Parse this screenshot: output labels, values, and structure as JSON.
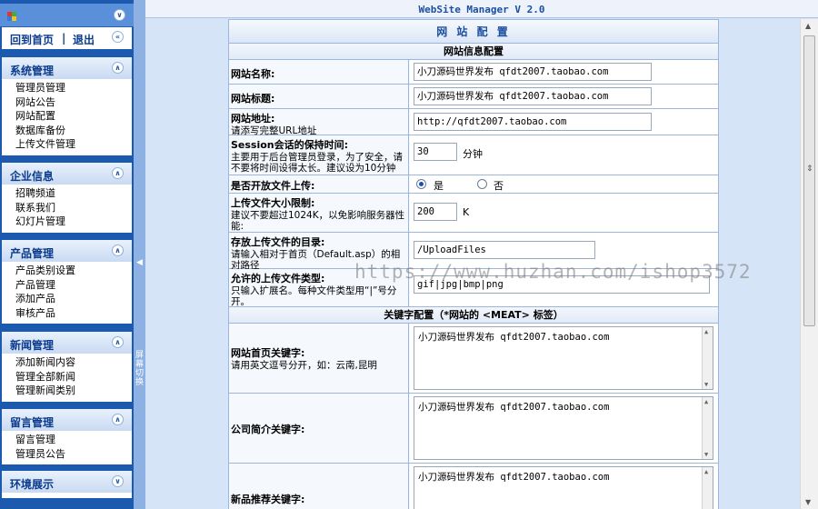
{
  "app": {
    "title": "WebSite Manager V 2.0"
  },
  "sidebar": {
    "home_link": "回到首页",
    "separator": "|",
    "logout_link": "退出",
    "groups": [
      {
        "title": "系统管理",
        "items": [
          "管理员管理",
          "网站公告",
          "网站配置",
          "数据库备份",
          "上传文件管理"
        ]
      },
      {
        "title": "企业信息",
        "items": [
          "招聘频道",
          "联系我们",
          "幻灯片管理"
        ]
      },
      {
        "title": "产品管理",
        "items": [
          "产品类别设置",
          "产品管理",
          "添加产品",
          "审核产品"
        ]
      },
      {
        "title": "新闻管理",
        "items": [
          "添加新闻内容",
          "管理全部新闻",
          "管理新闻类别"
        ]
      },
      {
        "title": "留言管理",
        "items": [
          "留言管理",
          "管理员公告"
        ]
      },
      {
        "title": "环境展示",
        "items": []
      }
    ]
  },
  "splitter": {
    "label": "屏幕切换"
  },
  "form": {
    "caption": "网 站 配 置",
    "section_info": "网站信息配置",
    "site_name": {
      "label": "网站名称:",
      "value": "小刀源码世界发布 qfdt2007.taobao.com"
    },
    "site_title": {
      "label": "网站标题:",
      "value": "小刀源码世界发布 qfdt2007.taobao.com"
    },
    "site_url": {
      "label": "网站地址:",
      "hint": "请添写完整URL地址",
      "value": "http://qfdt2007.taobao.com"
    },
    "session": {
      "label": "Session会话的保持时间:",
      "hint": "主要用于后台管理员登录，为了安全，请不要将时间设得太长。建议设为10分钟",
      "value": "30",
      "unit": "分钟"
    },
    "upload_open": {
      "label": "是否开放文件上传:",
      "yes": "是",
      "no": "否",
      "selected": "yes"
    },
    "upload_size": {
      "label": "上传文件大小限制:",
      "hint": "建议不要超过1024K，以免影响服务器性能:",
      "value": "200",
      "unit": "K"
    },
    "upload_dir": {
      "label": "存放上传文件的目录:",
      "hint": "请输入相对于首页（Default.asp）的相对路径",
      "value": "/UploadFiles"
    },
    "upload_types": {
      "label": "允许的上传文件类型:",
      "hint": "只输入扩展名。每种文件类型用“|”号分开。",
      "value": "gif|jpg|bmp|png"
    },
    "section_keywords": "关键字配置（*网站的 <MEAT> 标签）",
    "kw_home": {
      "label": "网站首页关键字:",
      "hint": "请用英文逗号分开，如：云南,昆明",
      "value": "小刀源码世界发布 qfdt2007.taobao.com"
    },
    "kw_company": {
      "label": "公司简介关键字:",
      "value": "小刀源码世界发布 qfdt2007.taobao.com"
    },
    "kw_newproducts": {
      "label": "新品推荐关键字:",
      "value": "小刀源码世界发布 qfdt2007.taobao.com"
    }
  },
  "watermark": "https://www.huzhan.com/ishop3572",
  "colors": {
    "sidebar_bg": "#1c5ab0",
    "content_bg": "#d6e4f7",
    "title_text": "#1c4fa0"
  }
}
